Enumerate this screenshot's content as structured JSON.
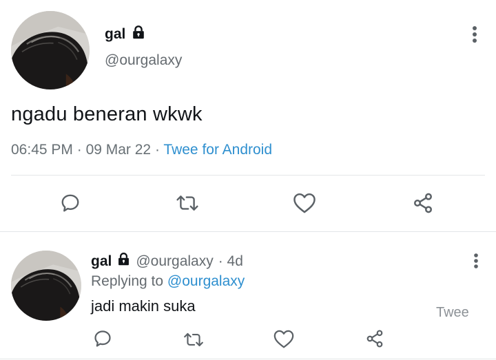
{
  "tweet": {
    "name": "gal",
    "handle": "@ourgalaxy",
    "text": "ngadu beneran wkwk",
    "time": "06:45 PM",
    "separator": " · ",
    "date": "09 Mar 22",
    "client": "Twee for Android",
    "icons": {
      "lock": "lock-icon",
      "menu": "more-vertical-icon",
      "reply": "comment-icon",
      "retweet": "retweet-icon",
      "like": "heart-icon",
      "share": "share-icon"
    }
  },
  "reply": {
    "name": "gal",
    "handle": "@ourgalaxy",
    "age": "· 4d",
    "replying_prefix": "Replying to ",
    "replying_handle": "@ourgalaxy",
    "text": "jadi makin suka",
    "client": "Twee",
    "icons": {
      "lock": "lock-icon",
      "menu": "more-vertical-icon",
      "reply": "comment-icon",
      "retweet": "retweet-icon",
      "like": "heart-icon",
      "share": "share-icon"
    }
  },
  "colors": {
    "text": "#111418",
    "muted": "#656b70",
    "link": "#2e8fcf",
    "icon": "#5b6166",
    "divider": "#e3e6e8"
  }
}
